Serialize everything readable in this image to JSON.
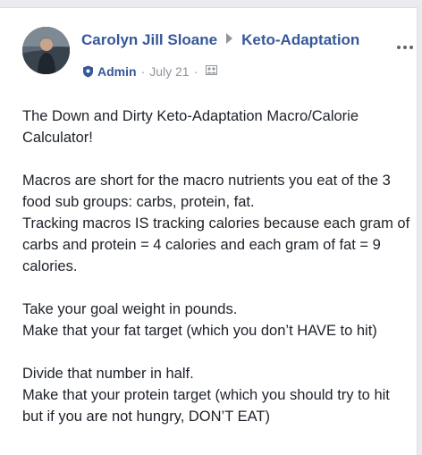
{
  "post": {
    "author": "Carolyn Jill Sloane",
    "group": "Keto-Adaptation",
    "role_badge": "Admin",
    "date": "July 21",
    "paragraphs": [
      [
        "The Down and Dirty Keto-Adaptation Macro/Calorie Calculator!"
      ],
      [
        "Macros are short for the macro nutrients you eat of the 3 food sub groups: carbs, protein, fat.",
        "Tracking macros IS tracking calories because each gram of carbs and protein = 4 calories and each gram of fat = 9 calories."
      ],
      [
        "Take your goal weight in pounds.",
        "Make that your fat target (which you don’t HAVE to hit)"
      ],
      [
        "Divide that number in half.",
        "Make that your protein target (which you should try to hit but if you are not hungry, DON’T EAT)"
      ]
    ]
  },
  "icons": {
    "role_badge": "shield-icon",
    "privacy": "group-members-icon",
    "separator": "right-triangle-icon",
    "more": "ellipsis-icon"
  },
  "colors": {
    "link": "#365899",
    "meta": "#90949c",
    "text": "#1d2129"
  }
}
